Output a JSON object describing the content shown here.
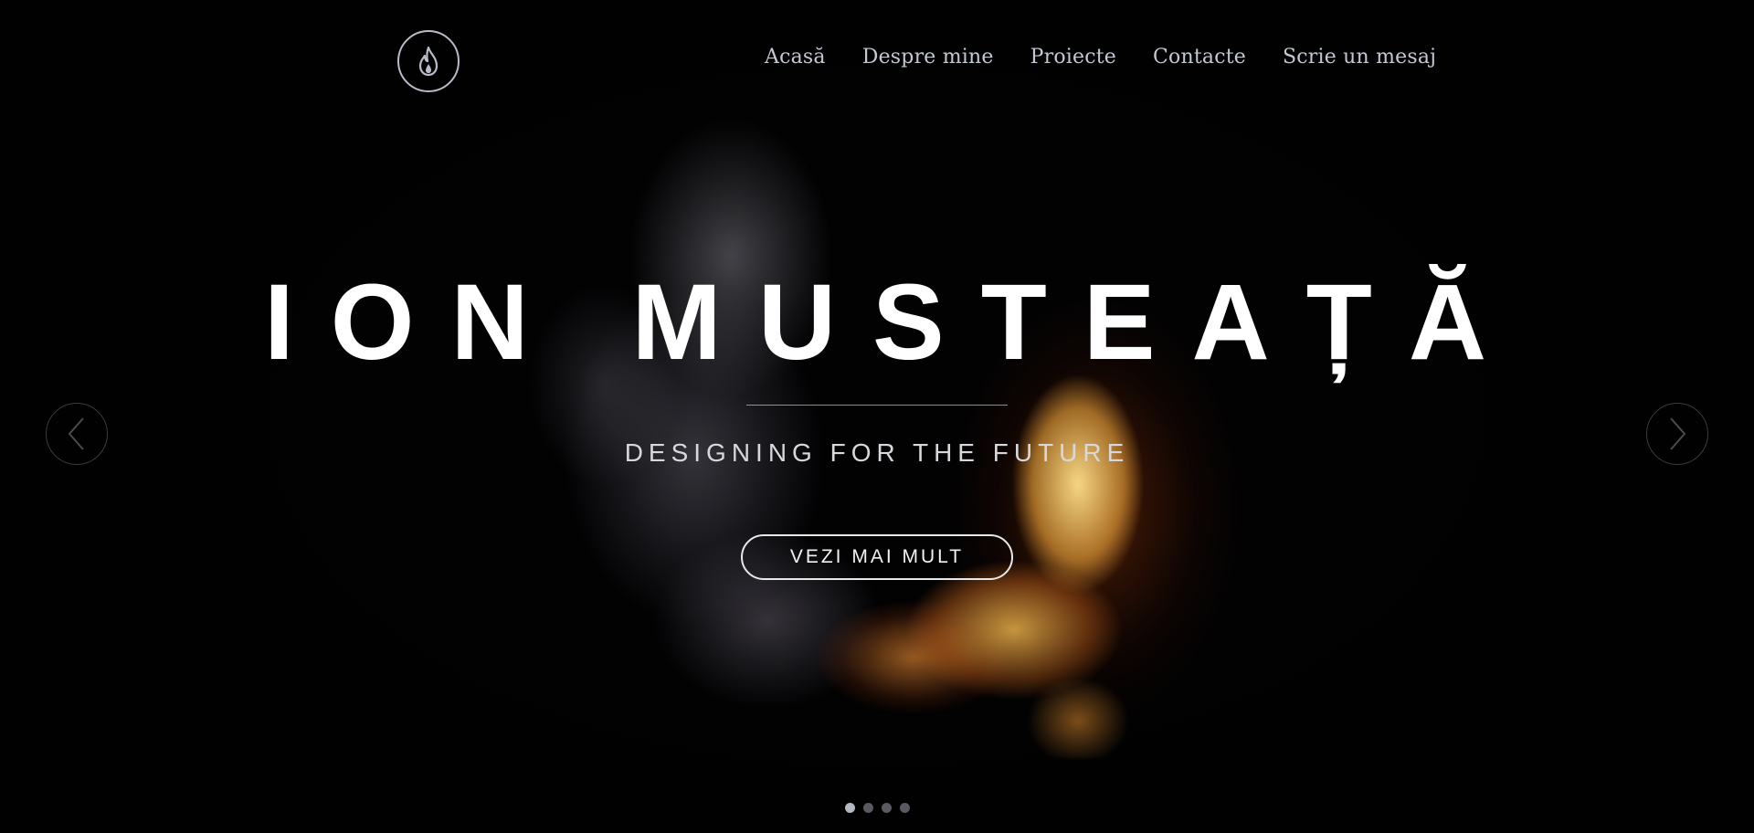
{
  "header": {
    "logo_icon": "flame-icon",
    "nav": [
      {
        "label": "Acasă"
      },
      {
        "label": "Despre mine"
      },
      {
        "label": "Proiecte"
      },
      {
        "label": "Contacte"
      },
      {
        "label": "Scrie un mesaj"
      }
    ]
  },
  "hero": {
    "title": "ION MUSTEAȚĂ",
    "subtitle": "DESIGNING FOR THE FUTURE",
    "cta_label": "VEZI MAI MULT",
    "prev_icon": "chevron-left-icon",
    "next_icon": "chevron-right-icon"
  },
  "slider": {
    "slide_count": 4,
    "active_index": 0
  },
  "colors": {
    "background": "#000000",
    "nav_text": "#c4c8d2",
    "logo_ring": "#b8bcc8",
    "fire": "#f5b040"
  }
}
